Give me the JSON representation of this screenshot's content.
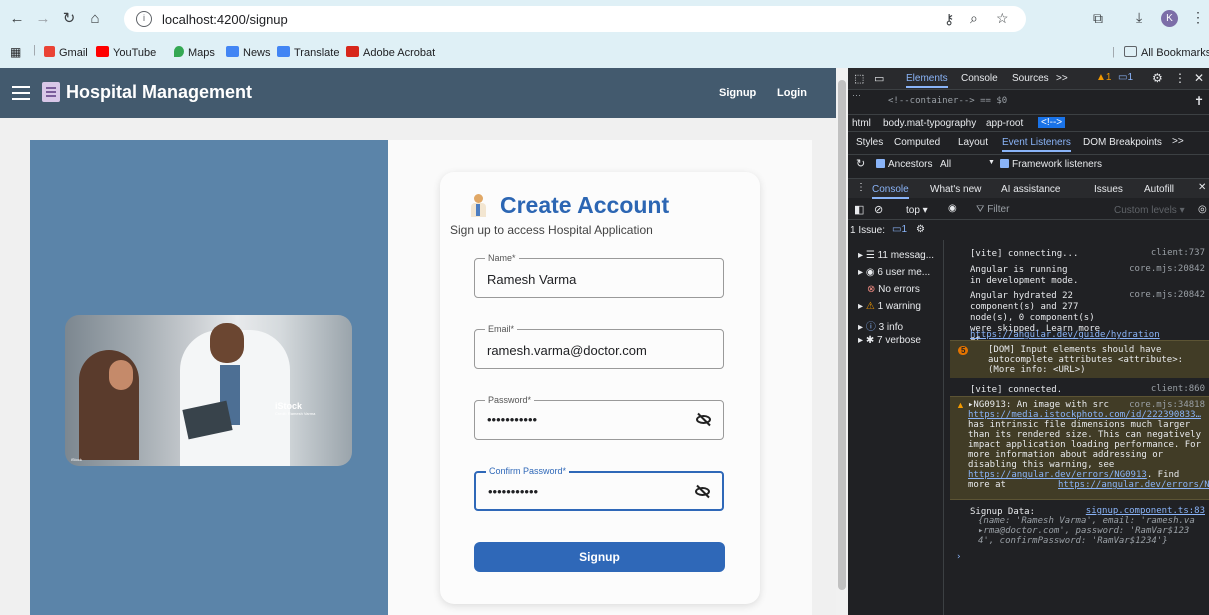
{
  "browser": {
    "url": "localhost:4200/signup",
    "bookmarks": [
      "Gmail",
      "YouTube",
      "Maps",
      "News",
      "Translate",
      "Adobe Acrobat"
    ],
    "all_bookmarks": "All Bookmarks",
    "profile_initial": "K"
  },
  "app": {
    "title": "Hospital Management",
    "nav": {
      "signup": "Signup",
      "login": "Login"
    },
    "photo": {
      "watermark": "iStock",
      "credit": "Credit: Ramesh Varma",
      "small": "iStock"
    },
    "card": {
      "title": "Create Account",
      "subtitle": "Sign up to access Hospital Application",
      "fields": [
        {
          "label": "Name*",
          "value": "Ramesh Varma"
        },
        {
          "label": "Email*",
          "value": "ramesh.varma@doctor.com"
        },
        {
          "label": "Password*",
          "value": "•••••••••••"
        },
        {
          "label": "Confirm Password*",
          "value": "•••••••••••"
        }
      ],
      "submit": "Signup"
    }
  },
  "devtools": {
    "top_tabs": [
      "Elements",
      "Console",
      "Sources"
    ],
    "more": ">>",
    "warn_count": "1",
    "issue_count": "1",
    "dom_line1": "<!--container--> == $0",
    "breadcrumb": [
      "html",
      "body.mat-typography",
      "app-root",
      "<!-->"
    ],
    "styles_tabs": [
      "Styles",
      "Computed",
      "Layout",
      "Event Listeners",
      "DOM Breakpoints"
    ],
    "ancestors": "Ancestors",
    "all": "All",
    "framework": "Framework listeners",
    "drawer_tabs": [
      "Console",
      "What's new",
      "AI assistance",
      "Issues",
      "Autofill"
    ],
    "console_toolbar": {
      "context": "top",
      "filter_placeholder": "Filter",
      "levels": "Custom levels"
    },
    "issues_line": "1 Issue:",
    "sidebar": [
      {
        "label": "11 messag...",
        "icon": "list-icon"
      },
      {
        "label": "6 user me...",
        "icon": "user-icon"
      },
      {
        "label": "No errors",
        "icon": "error-icon"
      },
      {
        "label": "1 warning",
        "icon": "warning-icon"
      },
      {
        "label": "3 info",
        "icon": "info-icon"
      },
      {
        "label": "7 verbose",
        "icon": "bug-icon"
      }
    ],
    "messages": {
      "m1": {
        "text": "[vite] connecting...",
        "src": "client:737"
      },
      "m2": {
        "text": "Angular is running in development mode.",
        "src": "core.mjs:20842"
      },
      "m3": {
        "text": "Angular hydrated 22 component(s) and 277 node(s), 0 component(s) were skipped. Learn more at",
        "link": "https://angular.dev/guide/hydration",
        "src": "core.mjs:20842"
      },
      "m4": {
        "badge": "5",
        "text": "[DOM] Input elements should have autocomplete attributes <attribute>: (More info: <URL>)"
      },
      "m5": {
        "text": "[vite] connected.",
        "src": "client:860"
      },
      "m6": {
        "prefix": "▸NG0913: An image with src",
        "link": "https://media.istockphoto.com/id/222390833…",
        "text": "has intrinsic file dimensions much larger than its rendered size. This can negatively impact application loading performance. For more information about addressing or disabling this warning, see",
        "link2": "https://angular.dev/errors/NG0913",
        "text2": ". Find more at",
        "link3": "https://angular.dev/errors/NG0913",
        "src": "core.mjs:34818"
      },
      "m7": {
        "label": "Signup Data:",
        "src": "signup.component.ts:83",
        "obj1": "{name: 'Ramesh Varma', email: 'ramesh.va",
        "obj2": "▸rma@doctor.com', password: 'RamVar$123",
        "obj3": "4', confirmPassword: 'RamVar$1234'}"
      }
    }
  }
}
